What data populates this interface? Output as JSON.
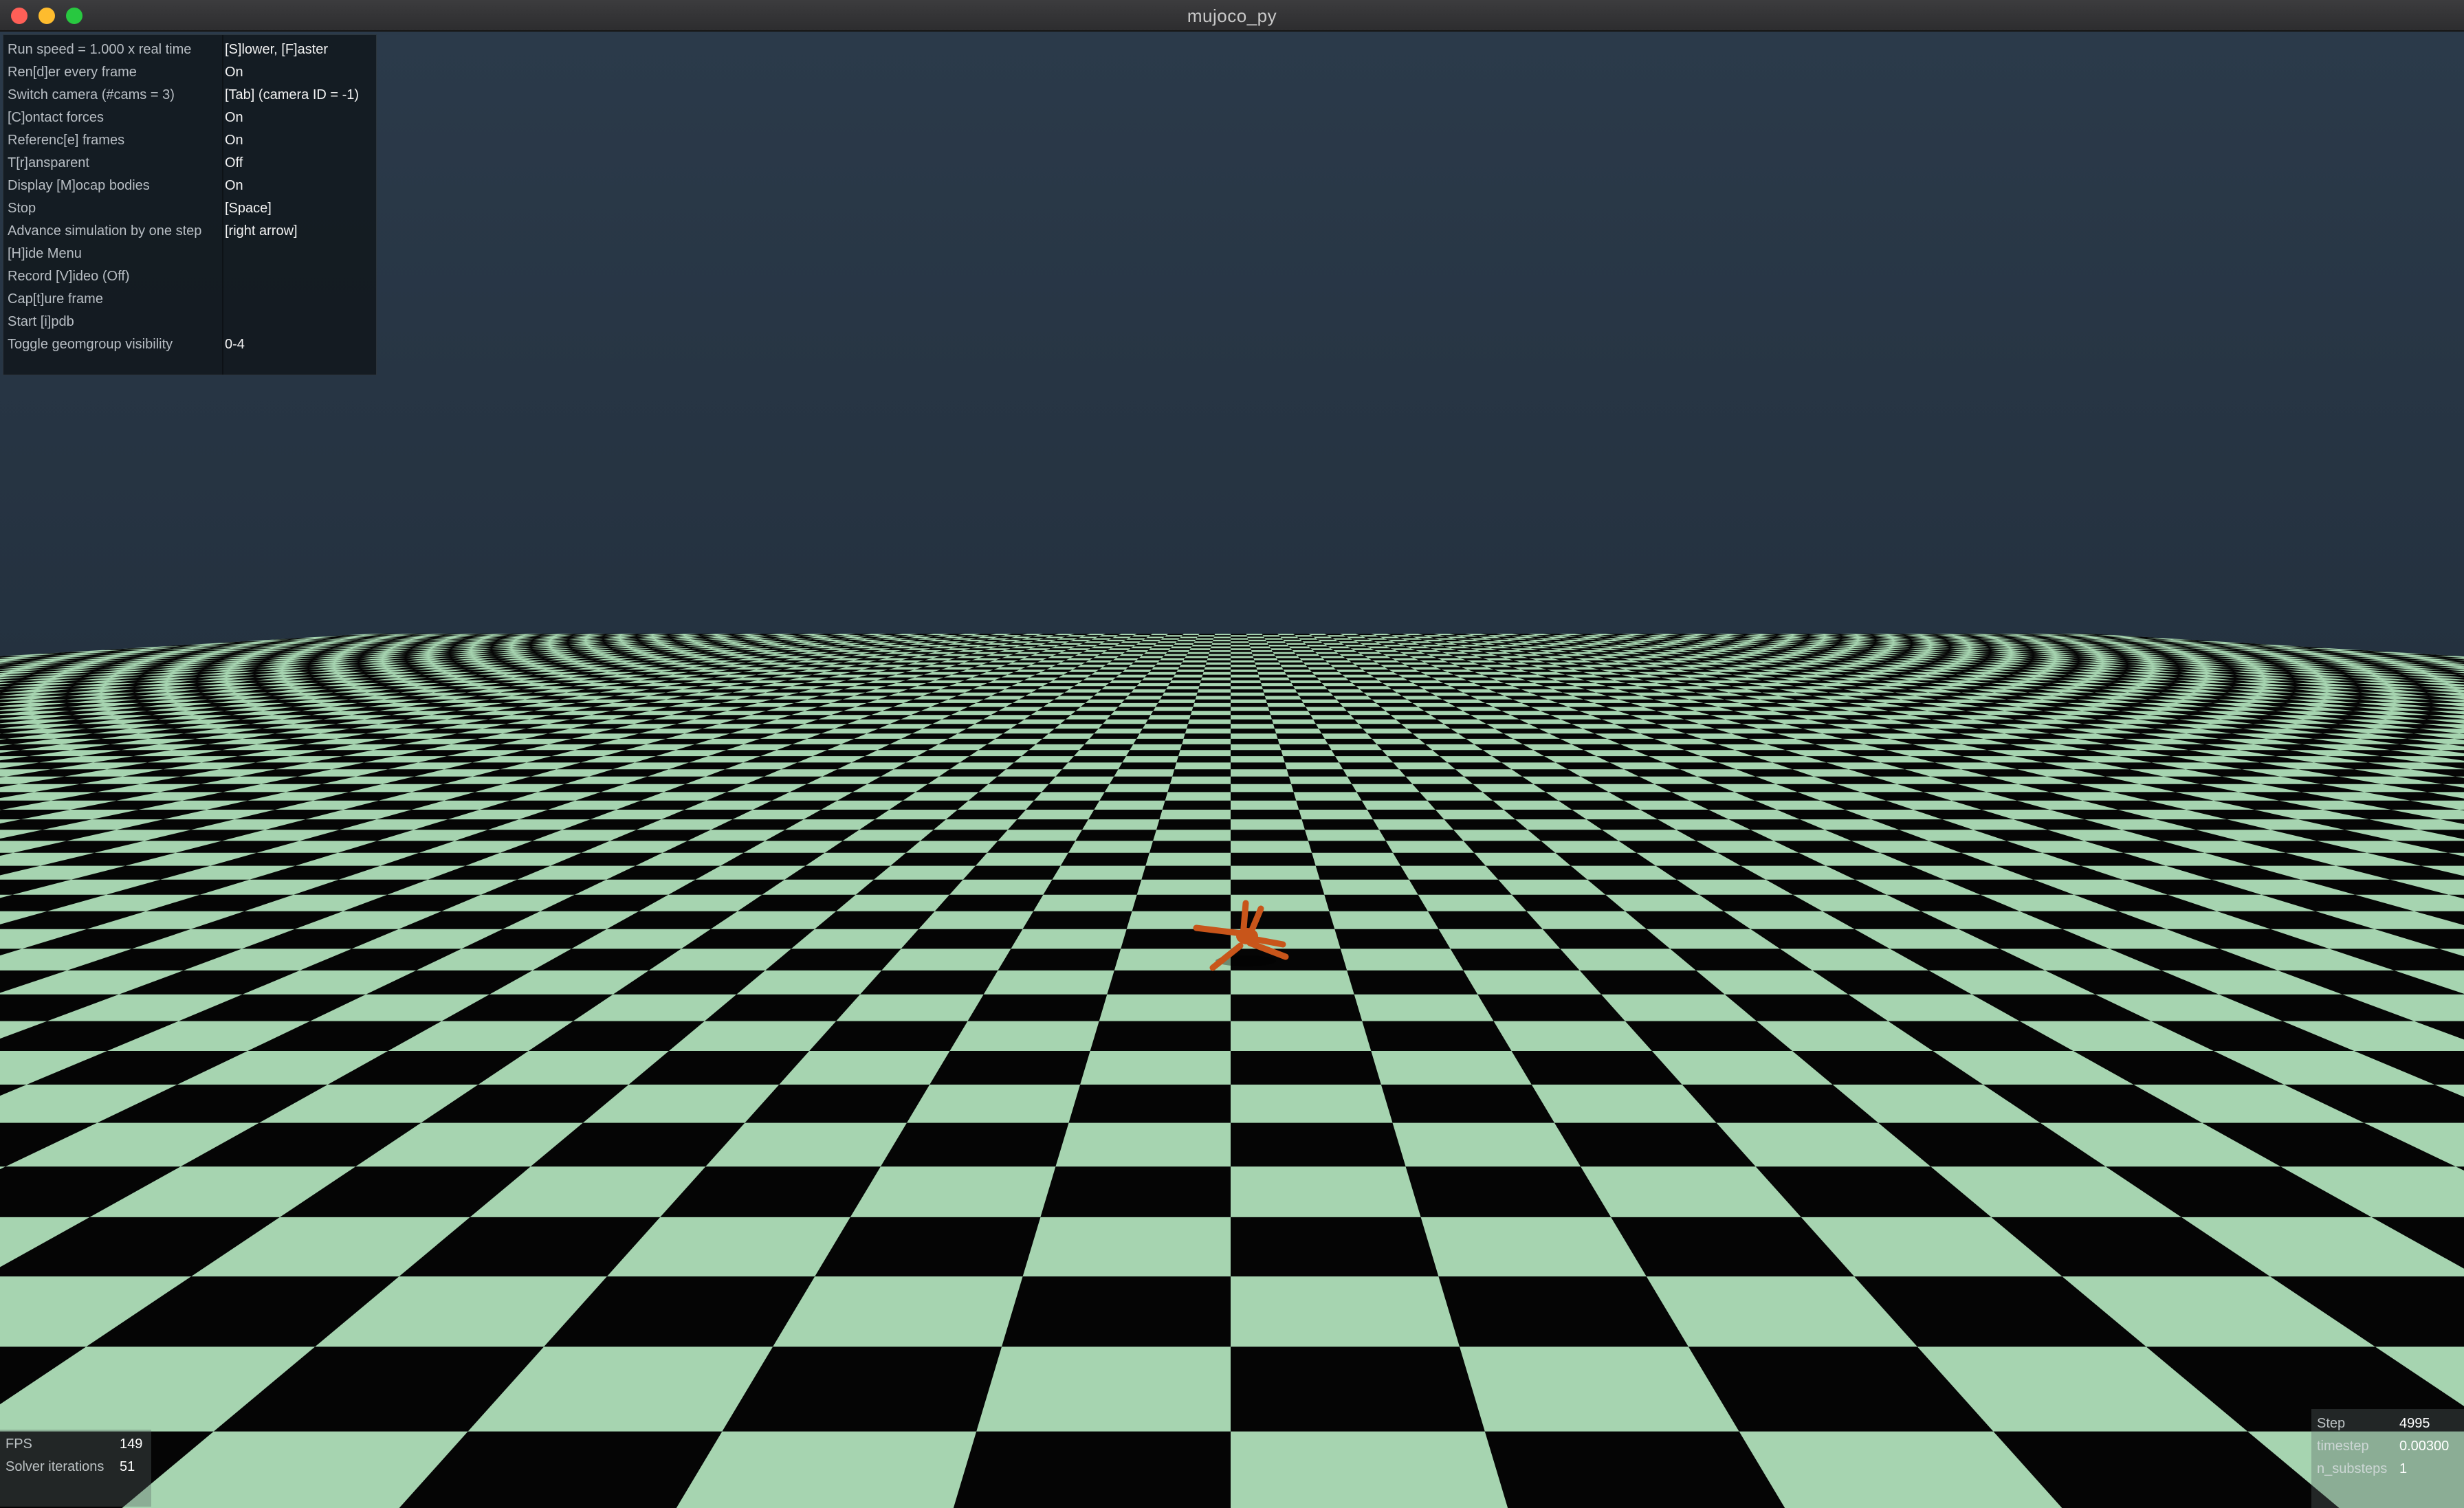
{
  "window": {
    "title": "mujoco_py"
  },
  "menu": {
    "items": [
      {
        "label": "Run speed = 1.000 x real time",
        "value": "[S]lower, [F]aster"
      },
      {
        "label": "Ren[d]er every frame",
        "value": "On"
      },
      {
        "label": "Switch camera (#cams = 3)",
        "value": "[Tab] (camera ID = -1)"
      },
      {
        "label": "[C]ontact forces",
        "value": "On"
      },
      {
        "label": "Referenc[e] frames",
        "value": "On"
      },
      {
        "label": "T[r]ansparent",
        "value": "Off"
      },
      {
        "label": "Display [M]ocap bodies",
        "value": "On"
      },
      {
        "label": "Stop",
        "value": "[Space]"
      },
      {
        "label": "Advance simulation by one step",
        "value": "[right arrow]"
      },
      {
        "label": "[H]ide Menu",
        "value": ""
      },
      {
        "label": "Record [V]ideo (Off)",
        "value": ""
      },
      {
        "label": "Cap[t]ure frame",
        "value": ""
      },
      {
        "label": "Start [i]pdb",
        "value": ""
      },
      {
        "label": "Toggle geomgroup visibility",
        "value": "0-4"
      }
    ]
  },
  "stats_left": [
    {
      "label": "FPS",
      "value": "149"
    },
    {
      "label": "Solver iterations",
      "value": "51"
    }
  ],
  "stats_right": [
    {
      "label": "Step",
      "value": "4995"
    },
    {
      "label": "timestep",
      "value": "0.00300"
    },
    {
      "label": "n_substeps",
      "value": "1"
    }
  ],
  "scene": {
    "sky_top_color": "#2b3a4a",
    "sky_bottom_color": "#1a2530",
    "floor_light_color": "#a6d4b0",
    "floor_dark_color": "#050505",
    "agent_color": "#c8551a"
  }
}
